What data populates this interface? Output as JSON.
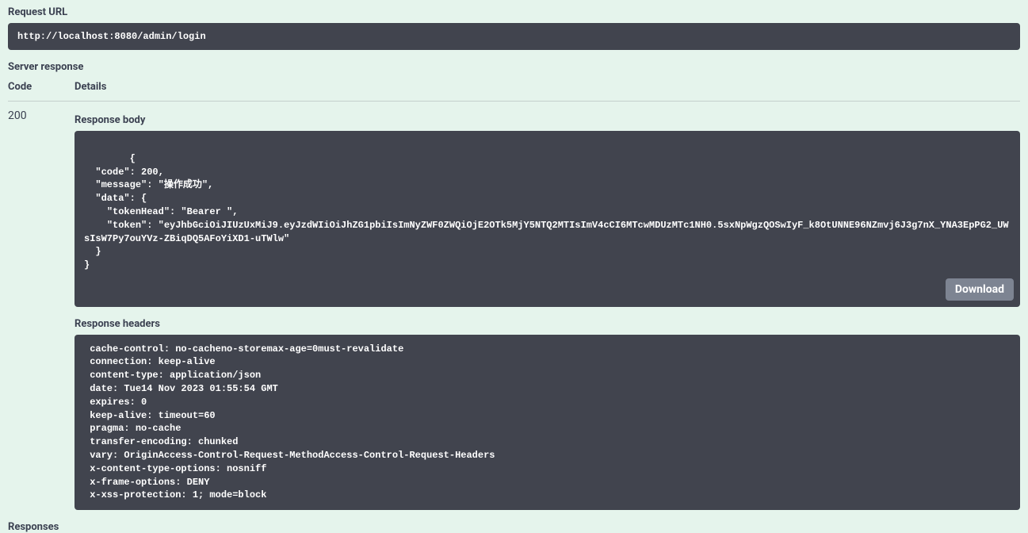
{
  "labels": {
    "request_url": "Request URL",
    "server_response": "Server response",
    "code": "Code",
    "details": "Details",
    "response_body": "Response body",
    "response_headers": "Response headers",
    "download": "Download",
    "responses": "Responses"
  },
  "request_url": "http://localhost:8080/admin/login",
  "status_code": "200",
  "response_body": "{\n  \"code\": 200,\n  \"message\": \"操作成功\",\n  \"data\": {\n    \"tokenHead\": \"Bearer \",\n    \"token\": \"eyJhbGciOiJIUzUxMiJ9.eyJzdWIiOiJhZG1pbiIsImNyZWF0ZWQiOjE2OTk5MjY5NTQ2MTIsImV4cCI6MTcwMDUzMTc1NH0.5sxNpWgzQOSwIyF_k8OtUNNE96NZmvj6J3g7nX_YNA3EpPG2_UWsIsW7Py7ouYVz-ZBiqDQ5AFoYiXD1-uTWlw\"\n  }\n}",
  "response_headers": " cache-control: no-cacheno-storemax-age=0must-revalidate \n connection: keep-alive \n content-type: application/json \n date: Tue14 Nov 2023 01:55:54 GMT \n expires: 0 \n keep-alive: timeout=60 \n pragma: no-cache \n transfer-encoding: chunked \n vary: OriginAccess-Control-Request-MethodAccess-Control-Request-Headers \n x-content-type-options: nosniff \n x-frame-options: DENY \n x-xss-protection: 1; mode=block "
}
